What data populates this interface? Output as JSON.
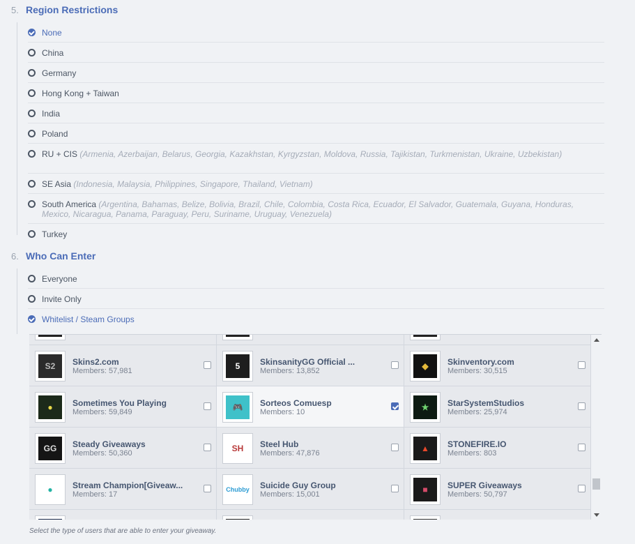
{
  "region": {
    "number": "5.",
    "title": "Region Restrictions",
    "options": [
      {
        "label": "None",
        "sub": "",
        "selected": true
      },
      {
        "label": "China",
        "sub": "",
        "selected": false
      },
      {
        "label": "Germany",
        "sub": "",
        "selected": false
      },
      {
        "label": "Hong Kong + Taiwan",
        "sub": "",
        "selected": false
      },
      {
        "label": "India",
        "sub": "",
        "selected": false
      },
      {
        "label": "Poland",
        "sub": "",
        "selected": false
      },
      {
        "label": "RU + CIS",
        "sub": "(Armenia, Azerbaijan, Belarus, Georgia, Kazakhstan, Kyrgyzstan, Moldova, Russia, Tajikistan, Turkmenistan, Ukraine, Uzbekistan)",
        "selected": false
      },
      {
        "label": "SE Asia",
        "sub": "(Indonesia, Malaysia, Philippines, Singapore, Thailand, Vietnam)",
        "selected": false
      },
      {
        "label": "South America",
        "sub": "(Argentina, Bahamas, Belize, Bolivia, Brazil, Chile, Colombia, Costa Rica, Ecuador, El Salvador, Guatemala, Guyana, Honduras, Mexico, Nicaragua, Panama, Paraguay, Peru, Suriname, Uruguay, Venezuela)",
        "selected": false
      },
      {
        "label": "Turkey",
        "sub": "",
        "selected": false
      }
    ]
  },
  "entry": {
    "number": "6.",
    "title": "Who Can Enter",
    "options": [
      {
        "label": "Everyone",
        "selected": false
      },
      {
        "label": "Invite Only",
        "selected": false
      },
      {
        "label": "Whitelist / Steam Groups",
        "selected": true
      }
    ]
  },
  "groups": [
    {
      "name": "",
      "members": "",
      "checked": false,
      "icon": "dark-partial",
      "bg": "#222"
    },
    {
      "name": "",
      "members": "",
      "checked": false,
      "icon": "dark-partial",
      "bg": "#222"
    },
    {
      "name": "",
      "members": "",
      "checked": false,
      "icon": "dark-partial",
      "bg": "#222"
    },
    {
      "name": "Skins2.com",
      "members": "Members: 57,981",
      "checked": false,
      "icon": "skins2-logo",
      "bg": "#2b2b2b"
    },
    {
      "name": "SkinsanityGG Official ...",
      "members": "Members: 13,852",
      "checked": false,
      "icon": "skinsanity-logo",
      "bg": "#1e1e1e"
    },
    {
      "name": "Skinventory.com",
      "members": "Members: 30,515",
      "checked": false,
      "icon": "skinventory-logo",
      "bg": "#111"
    },
    {
      "name": "Sometimes You Playing",
      "members": "Members: 59,849",
      "checked": false,
      "icon": "orb-logo",
      "bg": "#1c2a1a"
    },
    {
      "name": "Sorteos Comuesp",
      "members": "Members: 10",
      "checked": true,
      "icon": "gamepad-logo",
      "bg": "#3fc1c9"
    },
    {
      "name": "StarSystemStudios",
      "members": "Members: 25,974",
      "checked": false,
      "icon": "starsystem-logo",
      "bg": "#0d1b12"
    },
    {
      "name": "Steady Giveaways",
      "members": "Members: 50,360",
      "checked": false,
      "icon": "gg-logo",
      "bg": "#151515"
    },
    {
      "name": "Steel Hub",
      "members": "Members: 47,876",
      "checked": false,
      "icon": "sh-logo",
      "bg": "#ffffff"
    },
    {
      "name": "STONEFIRE.IO",
      "members": "Members: 803",
      "checked": false,
      "icon": "fire-logo",
      "bg": "#1a1a1a"
    },
    {
      "name": "Stream Champion[Giveaw...",
      "members": "Members: 17",
      "checked": false,
      "icon": "champion-logo",
      "bg": "#ffffff"
    },
    {
      "name": "Suicide Guy Group",
      "members": "Members: 15,001",
      "checked": false,
      "icon": "chubby-logo",
      "bg": "#ffffff"
    },
    {
      "name": "SUPER Giveaways",
      "members": "Members: 50,797",
      "checked": false,
      "icon": "gift-logo",
      "bg": "#1a1a1a"
    },
    {
      "name": "",
      "members": "",
      "checked": false,
      "icon": "dark-partial",
      "bg": "#1b2a4a"
    },
    {
      "name": "",
      "members": "",
      "checked": false,
      "icon": "dark-partial",
      "bg": "#222"
    },
    {
      "name": "",
      "members": "",
      "checked": false,
      "icon": "dark-partial",
      "bg": "#333"
    }
  ],
  "help_text": "Select the type of users that are able to enter your giveaway."
}
